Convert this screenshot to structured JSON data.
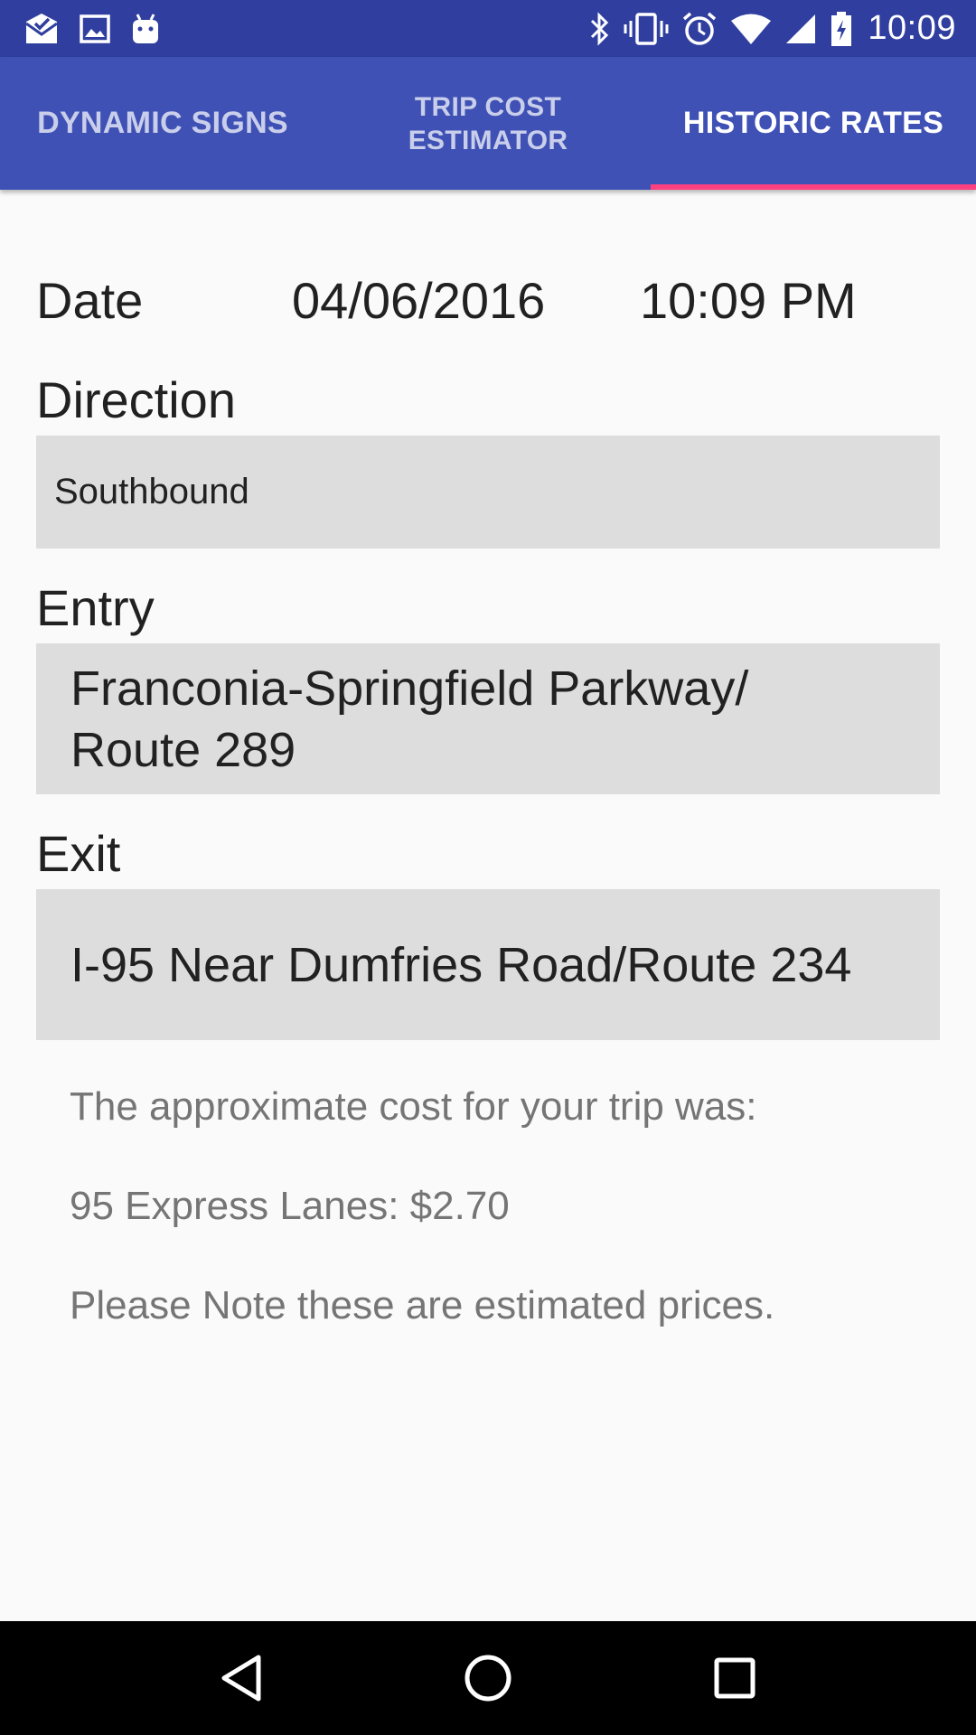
{
  "status_bar": {
    "time": "10:09",
    "left_icons": [
      "mail-check-icon",
      "image-icon",
      "android-icon"
    ],
    "right_icons": [
      "bluetooth-icon",
      "vibrate-icon",
      "alarm-icon",
      "wifi-icon",
      "signal-icon",
      "battery-charging-icon"
    ]
  },
  "tabs": [
    {
      "label": "DYNAMIC SIGNS",
      "active": false
    },
    {
      "label_line1": "TRIP COST",
      "label_line2": "ESTIMATOR",
      "active": false
    },
    {
      "label": "HISTORIC RATES",
      "active": true
    }
  ],
  "form": {
    "date_label": "Date",
    "date_value": "04/06/2016",
    "time_value": "10:09 PM",
    "direction_label": "Direction",
    "direction_value": "Southbound",
    "entry_label": "Entry",
    "entry_line1": "Franconia-Springfield Parkway/",
    "entry_line2": "Route 289",
    "exit_label": "Exit",
    "exit_value": "I-95 Near Dumfries Road/Route 234"
  },
  "result": {
    "intro": "The approximate cost for your trip was:",
    "cost": "95 Express Lanes: $2.70",
    "note": "Please Note these are estimated prices."
  },
  "colors": {
    "status_bar": "#303f9f",
    "app_bar": "#3f51b5",
    "tab_indicator": "#ff4081",
    "field_background": "#dddddd"
  },
  "nav_bar": [
    "back-icon",
    "home-icon",
    "recents-icon"
  ]
}
